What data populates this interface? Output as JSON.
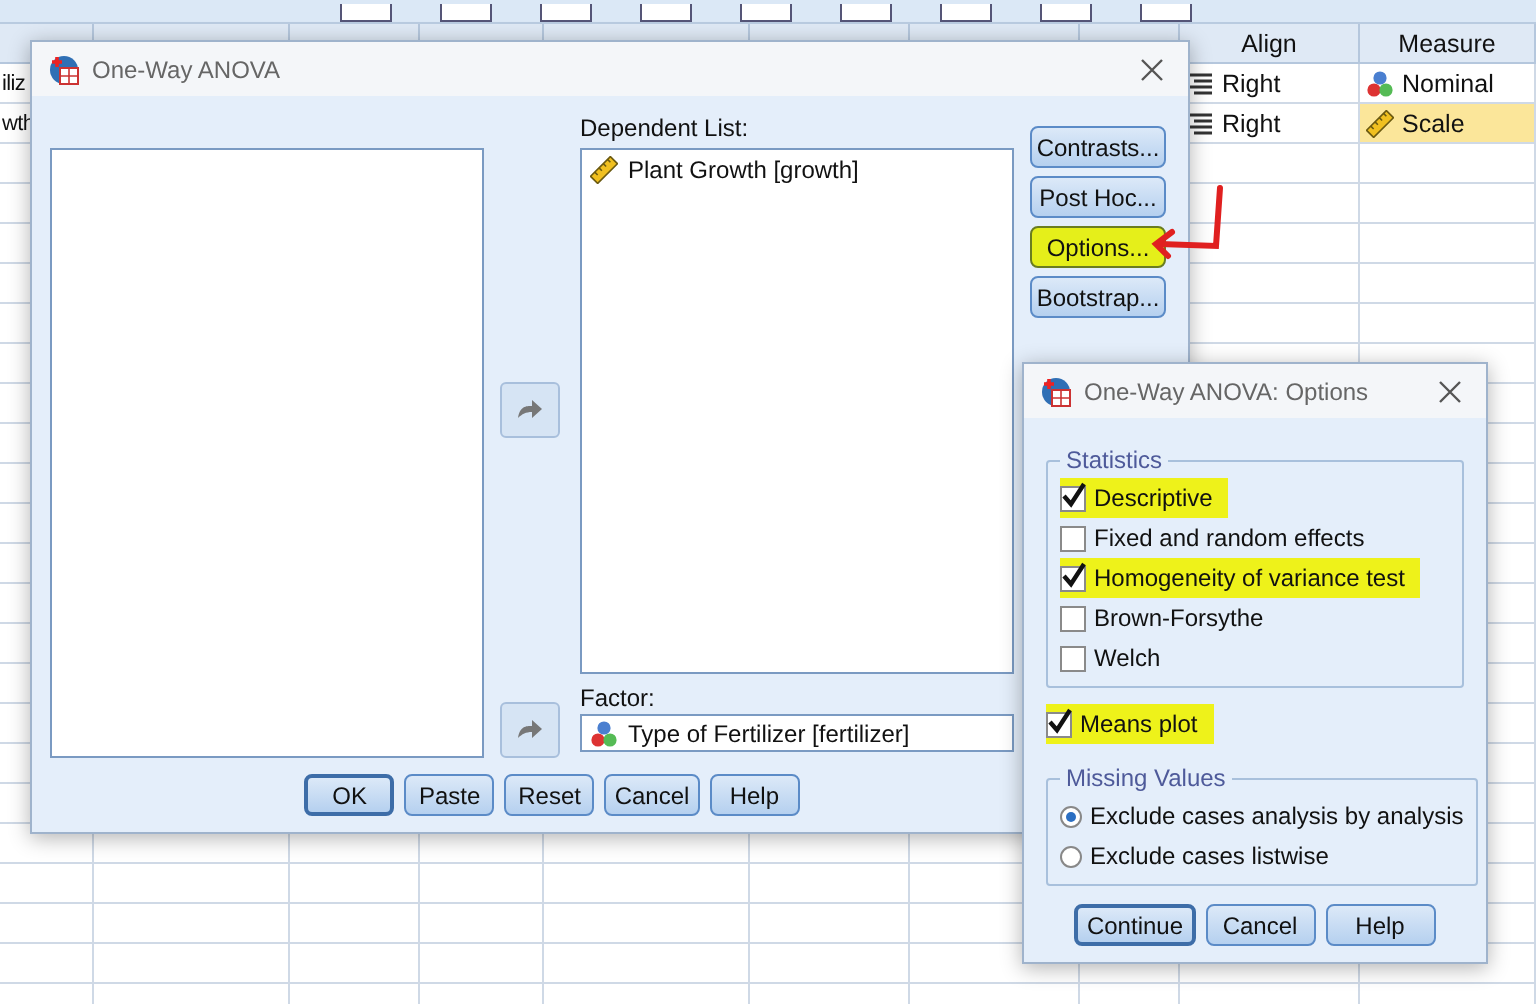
{
  "data_editor": {
    "columns": [
      {
        "label": "Align"
      },
      {
        "label": "Measure"
      }
    ],
    "rows": [
      {
        "name_fragment": "iliz",
        "cells": [
          {
            "text": "Right",
            "kind": "align",
            "selected": false
          },
          {
            "text": "Nominal",
            "kind": "nominal",
            "selected": false
          }
        ]
      },
      {
        "name_fragment": "wth",
        "cells": [
          {
            "text": "Right",
            "kind": "align",
            "selected": false
          },
          {
            "text": "Scale",
            "kind": "scale",
            "selected": true
          }
        ]
      }
    ]
  },
  "main_dialog": {
    "title": "One-Way ANOVA",
    "dependent_label": "Dependent List:",
    "dependent_items": [
      {
        "text": "Plant Growth [growth]",
        "kind": "scale"
      }
    ],
    "factor_label": "Factor:",
    "factor": {
      "text": "Type of Fertilizer [fertilizer]",
      "kind": "nominal"
    },
    "side_buttons": [
      {
        "label": "Contrasts...",
        "highlighted": false
      },
      {
        "label": "Post Hoc...",
        "highlighted": false
      },
      {
        "label": "Options...",
        "highlighted": true
      },
      {
        "label": "Bootstrap...",
        "highlighted": false
      }
    ],
    "buttons": [
      {
        "label": "OK",
        "default": true
      },
      {
        "label": "Paste",
        "default": false
      },
      {
        "label": "Reset",
        "default": false
      },
      {
        "label": "Cancel",
        "default": false
      },
      {
        "label": "Help",
        "default": false
      }
    ]
  },
  "options_dialog": {
    "title": "One-Way ANOVA: Options",
    "statistics_label": "Statistics",
    "statistics": [
      {
        "label": "Descriptive",
        "checked": true,
        "highlighted": true
      },
      {
        "label": "Fixed and random effects",
        "checked": false,
        "highlighted": false
      },
      {
        "label": "Homogeneity of variance test",
        "checked": true,
        "highlighted": true
      },
      {
        "label": "Brown-Forsythe",
        "checked": false,
        "highlighted": false
      },
      {
        "label": "Welch",
        "checked": false,
        "highlighted": false
      }
    ],
    "means_plot": {
      "label": "Means plot",
      "checked": true,
      "highlighted": true
    },
    "missing_label": "Missing Values",
    "missing": [
      {
        "label": "Exclude cases analysis by analysis",
        "selected": true
      },
      {
        "label": "Exclude cases listwise",
        "selected": false
      }
    ],
    "buttons": [
      {
        "label": "Continue",
        "default": true
      },
      {
        "label": "Cancel",
        "default": false
      },
      {
        "label": "Help",
        "default": false
      }
    ]
  }
}
